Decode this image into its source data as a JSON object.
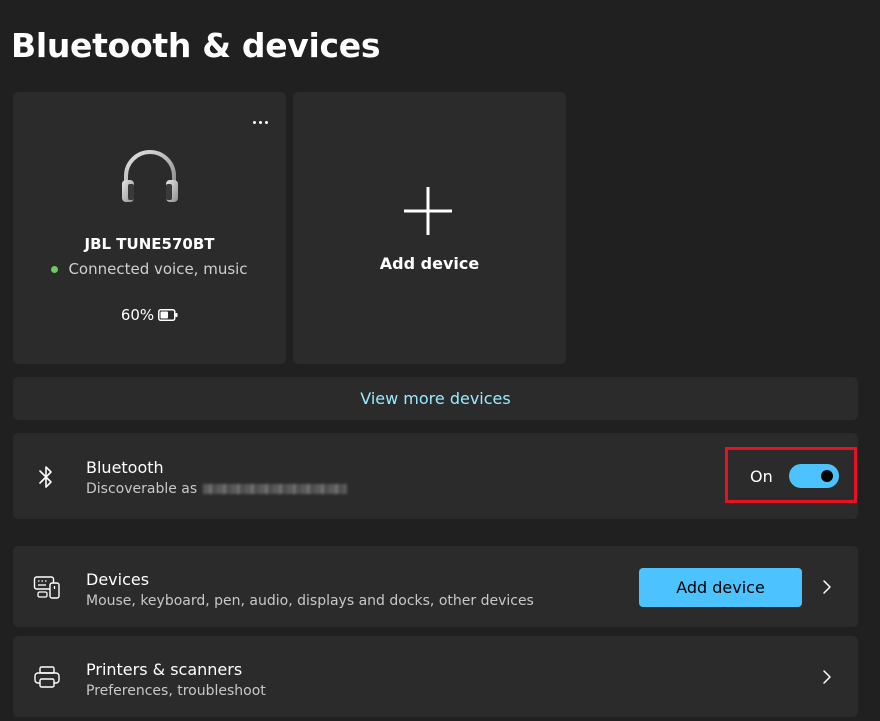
{
  "page": {
    "title": "Bluetooth & devices"
  },
  "device_card": {
    "name": "JBL TUNE570BT",
    "status": "Connected voice, music",
    "battery": "60%",
    "battery_level": 0.6,
    "icon": "headphones-icon",
    "status_color": "#6ccb5f"
  },
  "add_device_card": {
    "label": "Add device",
    "icon": "plus-icon"
  },
  "view_more": {
    "label": "View more devices"
  },
  "bluetooth": {
    "title": "Bluetooth",
    "subtitle_prefix": "Discoverable as",
    "toggle_label": "On",
    "toggle_on": true,
    "icon": "bluetooth-icon"
  },
  "devices_row": {
    "title": "Devices",
    "subtitle": "Mouse, keyboard, pen, audio, displays and docks, other devices",
    "button_label": "Add device",
    "icon": "devices-icon"
  },
  "printers_row": {
    "title": "Printers & scanners",
    "subtitle": "Preferences, troubleshoot",
    "icon": "printer-icon"
  },
  "colors": {
    "accent": "#4cc2ff",
    "link": "#99ebff",
    "highlight": "#e81123"
  }
}
